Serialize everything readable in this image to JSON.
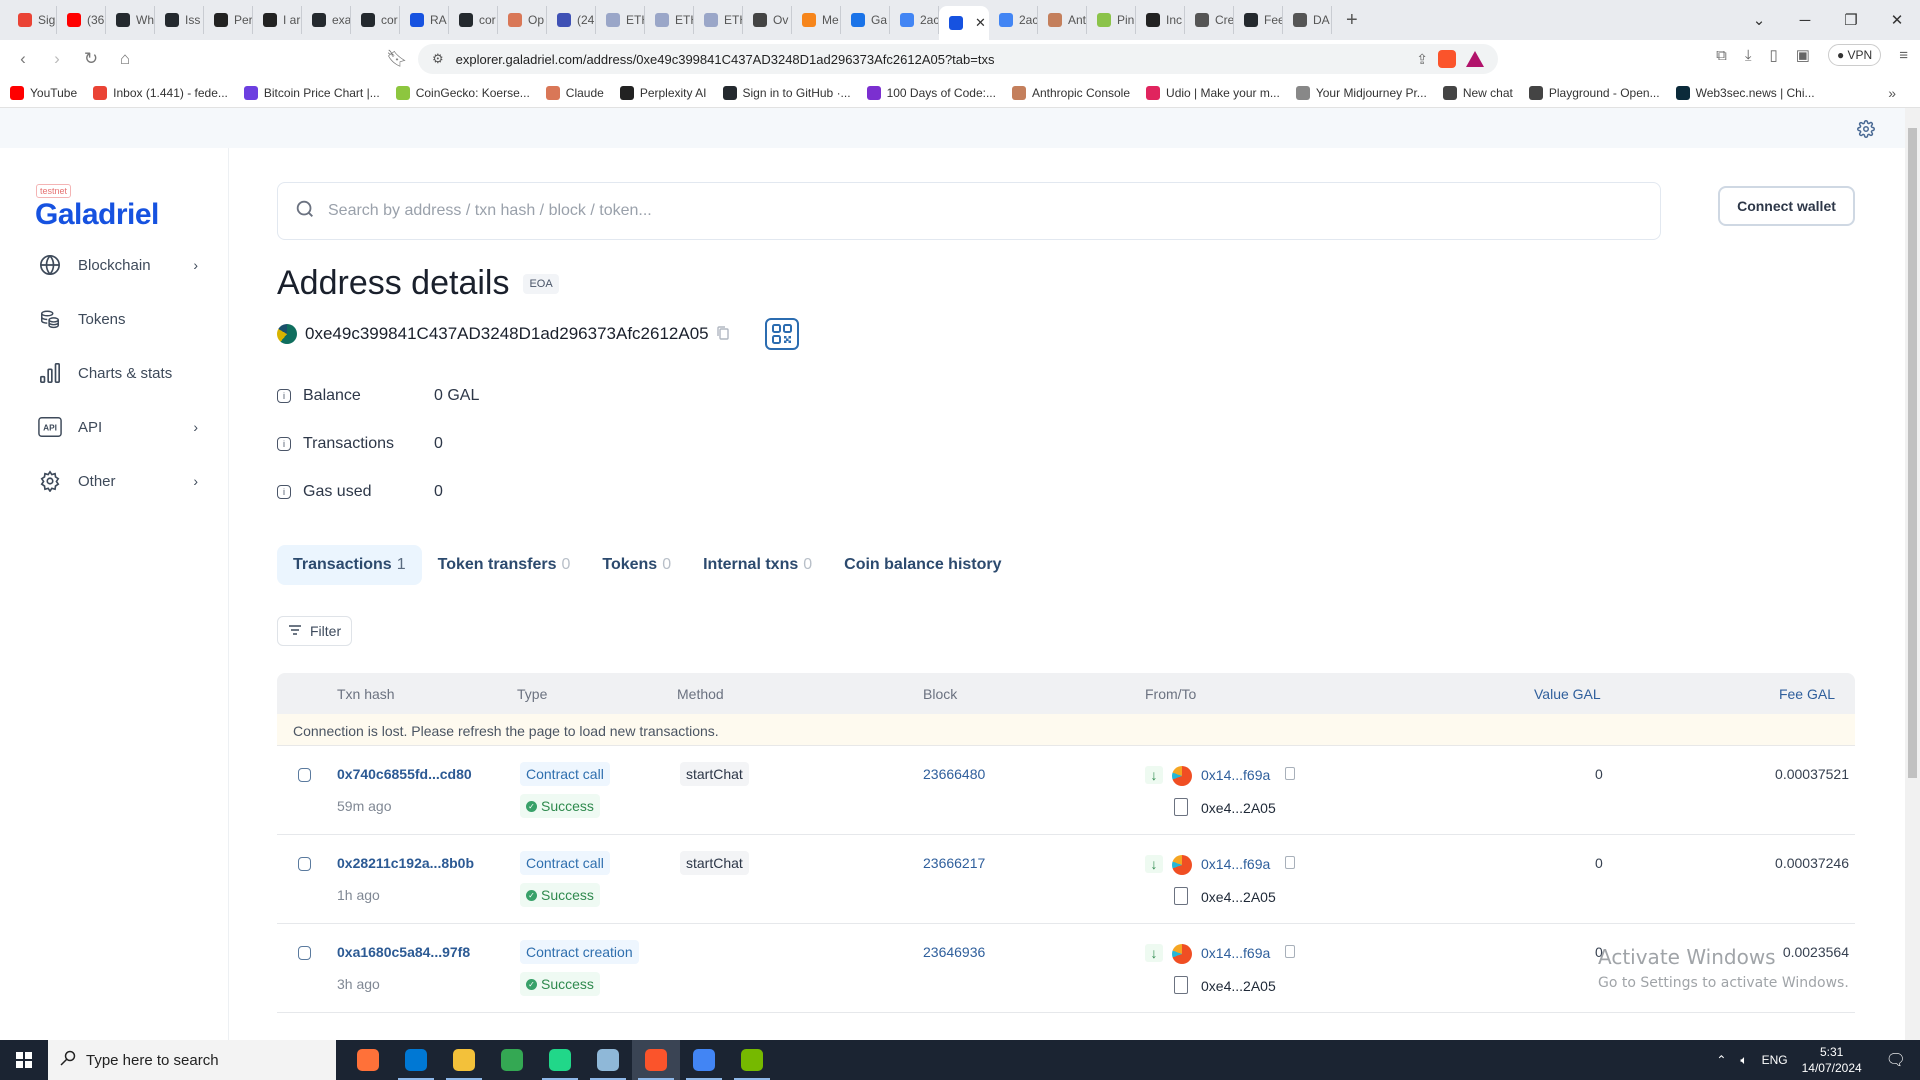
{
  "browser": {
    "tabs": [
      {
        "label": "Sig",
        "color": "#ea4335"
      },
      {
        "label": "(36",
        "color": "#ff0000"
      },
      {
        "label": "Wh",
        "color": "#24292e"
      },
      {
        "label": "Iss",
        "color": "#24292e"
      },
      {
        "label": "Per",
        "color": "#222222"
      },
      {
        "label": "I ar",
        "color": "#222222"
      },
      {
        "label": "exa",
        "color": "#24292e"
      },
      {
        "label": "cor",
        "color": "#24292e"
      },
      {
        "label": "RA",
        "color": "#1652e0"
      },
      {
        "label": "cor",
        "color": "#24292e"
      },
      {
        "label": "Op",
        "color": "#d97757"
      },
      {
        "label": "(24",
        "color": "#3f51b5"
      },
      {
        "label": "ETH",
        "color": "#9aa6c8"
      },
      {
        "label": "ETH",
        "color": "#9aa6c8"
      },
      {
        "label": "ETH",
        "color": "#9aa6c8"
      },
      {
        "label": "Ov",
        "color": "#444444"
      },
      {
        "label": "Me",
        "color": "#f6851b"
      },
      {
        "label": "Ga",
        "color": "#1a73e8"
      },
      {
        "label": "2ac",
        "color": "#4285f4"
      },
      {
        "label": "",
        "color": "#1652e0",
        "active": true
      },
      {
        "label": "2ac",
        "color": "#4285f4"
      },
      {
        "label": "Ant",
        "color": "#c47f5c"
      },
      {
        "label": "Pin",
        "color": "#8bc34a"
      },
      {
        "label": "Inc",
        "color": "#222222"
      },
      {
        "label": "Cre",
        "color": "#555555"
      },
      {
        "label": "Fee",
        "color": "#24292e"
      },
      {
        "label": "DA",
        "color": "#555555"
      }
    ],
    "new_tab": "+",
    "url": "explorer.galadriel.com/address/0xe49c399841C437AD3248D1ad296373Afc2612A05?tab=txs",
    "brave_badge": "1",
    "vpn_label": "VPN",
    "bookmarks": [
      {
        "label": "YouTube",
        "color": "#ff0000"
      },
      {
        "label": "Inbox (1.441) - fede...",
        "color": "#ea4335"
      },
      {
        "label": "Bitcoin Price Chart |...",
        "color": "#6c3fe0"
      },
      {
        "label": "CoinGecko: Koerse...",
        "color": "#8dc63f"
      },
      {
        "label": "Claude",
        "color": "#d97757"
      },
      {
        "label": "Perplexity AI",
        "color": "#222222"
      },
      {
        "label": "Sign in to GitHub ·...",
        "color": "#24292e"
      },
      {
        "label": "100 Days of Code:...",
        "color": "#7b2fd0"
      },
      {
        "label": "Anthropic Console",
        "color": "#c47f5c"
      },
      {
        "label": "Udio | Make your m...",
        "color": "#e0245e"
      },
      {
        "label": "Your Midjourney Pr...",
        "color": "#888888"
      },
      {
        "label": "New chat",
        "color": "#444444"
      },
      {
        "label": "Playground - Open...",
        "color": "#444444"
      },
      {
        "label": "Web3sec.news | Chi...",
        "color": "#0b2a3a"
      }
    ],
    "bookmarks_more": "»"
  },
  "sidebar": {
    "network_badge": "testnet",
    "logo": "Galadriel",
    "items": [
      {
        "label": "Blockchain",
        "icon": "globe-icon",
        "has_submenu": true
      },
      {
        "label": "Tokens",
        "icon": "coins-icon",
        "has_submenu": false
      },
      {
        "label": "Charts & stats",
        "icon": "bar-chart-icon",
        "has_submenu": false
      },
      {
        "label": "API",
        "icon": "api-icon",
        "has_submenu": true
      },
      {
        "label": "Other",
        "icon": "gear-icon",
        "has_submenu": true
      }
    ]
  },
  "header": {
    "search_placeholder": "Search by address / txn hash / block / token...",
    "connect_wallet": "Connect wallet"
  },
  "address": {
    "title": "Address details",
    "badge": "EOA",
    "hash": "0xe49c399841C437AD3248D1ad296373Afc2612A05",
    "info": [
      {
        "label": "Balance",
        "value": "0 GAL"
      },
      {
        "label": "Transactions",
        "value": "0"
      },
      {
        "label": "Gas used",
        "value": "0"
      }
    ]
  },
  "tabs": [
    {
      "label": "Transactions",
      "count": "1",
      "active": true
    },
    {
      "label": "Token transfers",
      "count": "0"
    },
    {
      "label": "Tokens",
      "count": "0"
    },
    {
      "label": "Internal txns",
      "count": "0"
    },
    {
      "label": "Coin balance history",
      "count": ""
    }
  ],
  "filter_label": "Filter",
  "table": {
    "columns": {
      "txn_hash": "Txn hash",
      "type": "Type",
      "method": "Method",
      "block": "Block",
      "from_to": "From/To",
      "value": "Value GAL",
      "fee": "Fee GAL"
    },
    "notice": "Connection is lost. Please refresh the page to load new transactions.",
    "rows": [
      {
        "hash": "0x740c6855fd...cd80",
        "age": "59m ago",
        "type": "Contract call",
        "status": "Success",
        "method": "startChat",
        "block": "23666480",
        "from": "0x14...f69a",
        "to": "0xe4...2A05",
        "value": "0",
        "fee": "0.00037521"
      },
      {
        "hash": "0x28211c192a...8b0b",
        "age": "1h ago",
        "type": "Contract call",
        "status": "Success",
        "method": "startChat",
        "block": "23666217",
        "from": "0x14...f69a",
        "to": "0xe4...2A05",
        "value": "0",
        "fee": "0.00037246"
      },
      {
        "hash": "0xa1680c5a84...97f8",
        "age": "3h ago",
        "type": "Contract creation",
        "status": "Success",
        "method": "",
        "block": "23646936",
        "from": "0x14...f69a",
        "to": "0xe4...2A05",
        "value": "0",
        "fee": "0.0023564"
      }
    ]
  },
  "watermark": {
    "line1": "Activate Windows",
    "line2": "Go to Settings to activate Windows."
  },
  "taskbar": {
    "search_placeholder": "Type here to search",
    "apps": [
      {
        "name": "firefox",
        "color": "#ff7139"
      },
      {
        "name": "vscode",
        "color": "#0078d4"
      },
      {
        "name": "file-explorer",
        "color": "#f3c13a"
      },
      {
        "name": "chrome",
        "color": "#34a853"
      },
      {
        "name": "pycharm",
        "color": "#21d789"
      },
      {
        "name": "notepad",
        "color": "#8fb8d8"
      },
      {
        "name": "brave",
        "color": "#fb542b"
      },
      {
        "name": "chrome-profile",
        "color": "#4285f4"
      },
      {
        "name": "nvidia",
        "color": "#76b900"
      }
    ],
    "language": "ENG",
    "time": "5:31",
    "date": "14/07/2024"
  }
}
